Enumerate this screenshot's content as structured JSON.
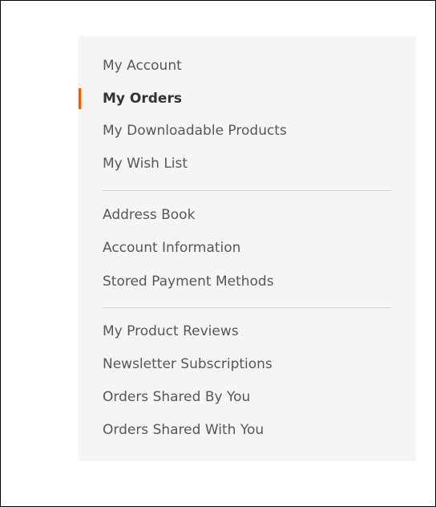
{
  "account_nav": {
    "group1": [
      {
        "label": "My Account",
        "current": false
      },
      {
        "label": "My Orders",
        "current": true
      },
      {
        "label": "My Downloadable Products",
        "current": false
      },
      {
        "label": "My Wish List",
        "current": false
      }
    ],
    "group2": [
      {
        "label": "Address Book"
      },
      {
        "label": "Account Information"
      },
      {
        "label": "Stored Payment Methods"
      }
    ],
    "group3": [
      {
        "label": "My Product Reviews"
      },
      {
        "label": "Newsletter Subscriptions"
      },
      {
        "label": "Orders Shared By You"
      },
      {
        "label": "Orders Shared With You"
      }
    ]
  },
  "colors": {
    "sidebar_background": "#f5f5f5",
    "current_marker": "#ff5501",
    "link_text": "#575757",
    "current_text": "#333333",
    "divider": "#d1d1d1"
  }
}
